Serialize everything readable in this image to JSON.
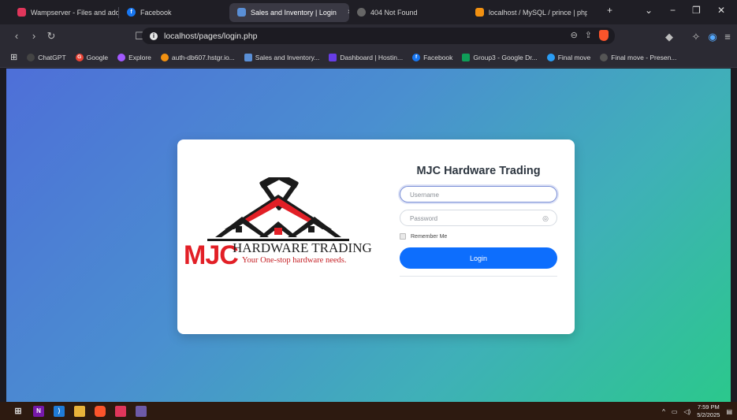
{
  "browser": {
    "tabs": [
      {
        "title": "Wampserver - Files and addons",
        "color": "#e0365b",
        "glyph": ""
      },
      {
        "title": "Facebook",
        "color": "#1877f2",
        "glyph": "f"
      },
      {
        "title": "Sales and Inventory | Login",
        "color": "#5a8fd6",
        "glyph": "",
        "active": true
      },
      {
        "title": "404 Not Found",
        "color": "#555",
        "glyph": ""
      },
      {
        "title": "localhost / MySQL / prince | php",
        "color": "#f29111",
        "glyph": ""
      }
    ],
    "close_glyph": "×",
    "new_tab_glyph": "+",
    "url": "localhost/pages/login.php",
    "bookmarks": [
      {
        "label": "ChatGPT",
        "color": "#444"
      },
      {
        "label": "Google",
        "color": "#ea4335"
      },
      {
        "label": "Explore",
        "color": "#a259ff"
      },
      {
        "label": "auth-db607.hstgr.io...",
        "color": "#f29111"
      },
      {
        "label": "Sales and Inventory...",
        "color": "#5a8fd6"
      },
      {
        "label": "Dashboard | Hostin...",
        "color": "#673de6"
      },
      {
        "label": "Facebook",
        "color": "#1877f2"
      },
      {
        "label": "Group3 - Google Dr...",
        "color": "#0f9d58"
      },
      {
        "label": "Final move",
        "color": "#2a9df4"
      },
      {
        "label": "Final move - Presen...",
        "color": "#555"
      }
    ]
  },
  "page": {
    "title": "MJC Hardware Trading",
    "username_placeholder": "Username",
    "password_placeholder": "Password",
    "remember_label": "Remember Me",
    "login_label": "Login",
    "logo": {
      "mark": "MJC",
      "name": "HARDWARE TRADING",
      "slogan": "Your One-stop hardware needs."
    }
  },
  "taskbar": {
    "time": "7:59 PM",
    "date": "5/2/2025"
  },
  "colors": {
    "primary_button": "#0d6efd",
    "logo_red": "#e21f26"
  }
}
